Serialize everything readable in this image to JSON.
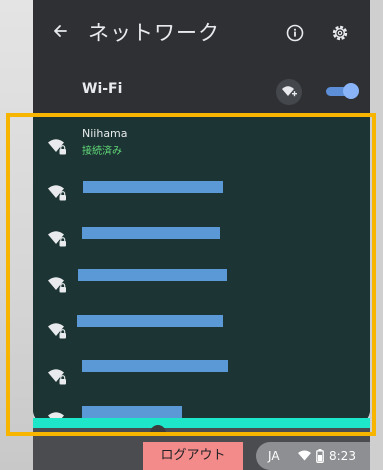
{
  "header": {
    "back_icon": "arrow-back-icon",
    "title": "ネットワーク",
    "info_icon": "info-icon",
    "settings_icon": "gear-icon"
  },
  "wifi": {
    "label": "Wi-Fi",
    "enabled": true,
    "add_network_icon": "add-wifi-icon"
  },
  "networks": [
    {
      "name": "Niihama",
      "status": "接続済み",
      "secured": true,
      "icon": "wifi-lock-icon"
    },
    {
      "name": "",
      "secured": true,
      "icon": "wifi-lock-icon",
      "redacted": true
    },
    {
      "name": "",
      "secured": true,
      "icon": "wifi-lock-icon",
      "redacted": true
    },
    {
      "name": "",
      "secured": true,
      "icon": "wifi-lock-icon",
      "redacted": true
    },
    {
      "name": "",
      "secured": true,
      "icon": "wifi-lock-icon",
      "redacted": true
    },
    {
      "name": "",
      "secured": true,
      "icon": "wifi-lock-icon",
      "redacted": true
    },
    {
      "name": "",
      "secured": true,
      "icon": "wifi-lock-icon",
      "redacted": true
    }
  ],
  "shelf": {
    "logout_label": "ログアウト",
    "language": "JA",
    "time": "8:23",
    "wifi_icon": "wifi-icon",
    "battery_icon": "battery-icon"
  },
  "colors": {
    "panel_bg": "#202124",
    "header_bg": "#2f3033",
    "list_bg": "#1c3434",
    "connected_status": "#62d978",
    "toggle_on": "#8ab4f8",
    "highlight": "#f7b500",
    "logout_bg": "#f38b8b",
    "redaction": "#5a99d6"
  }
}
